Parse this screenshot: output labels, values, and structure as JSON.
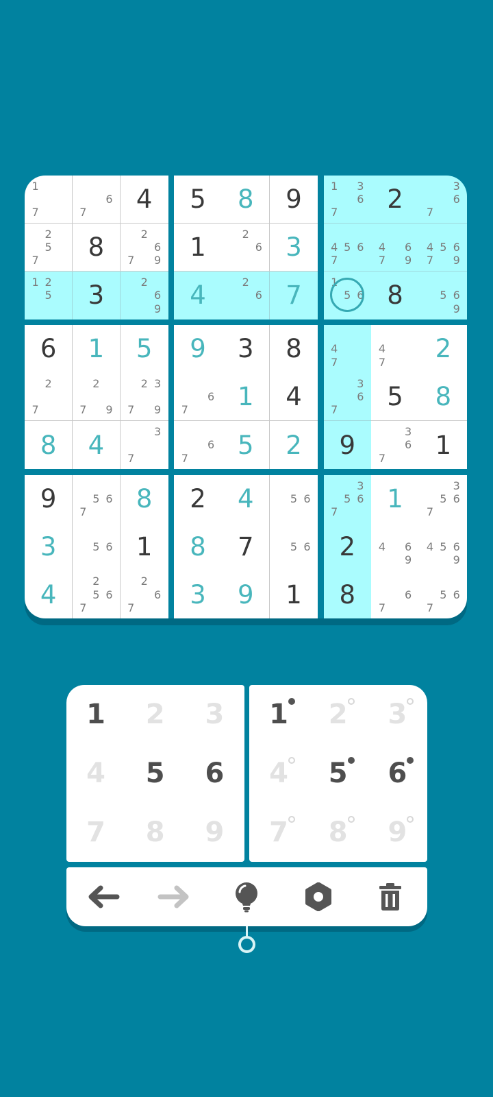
{
  "board": {
    "rows": [
      [
        {
          "n": [
            1,
            7
          ]
        },
        {
          "n": [
            6,
            7
          ]
        },
        {
          "v": 4,
          "t": "g"
        },
        {
          "v": 5,
          "t": "g"
        },
        {
          "v": 8,
          "t": "u"
        },
        {
          "v": 9,
          "t": "g"
        },
        {
          "n": [
            1,
            3,
            6,
            7
          ],
          "h": 1
        },
        {
          "v": 2,
          "t": "g",
          "h": 1
        },
        {
          "n": [
            3,
            6,
            7
          ],
          "h": 1
        }
      ],
      [
        {
          "n": [
            2,
            5,
            7
          ]
        },
        {
          "v": 8,
          "t": "g"
        },
        {
          "n": [
            2,
            6,
            7,
            9
          ]
        },
        {
          "v": 1,
          "t": "g"
        },
        {
          "n": [
            2,
            6
          ]
        },
        {
          "v": 3,
          "t": "u"
        },
        {
          "n": [
            4,
            5,
            6,
            7
          ],
          "h": 1
        },
        {
          "n": [
            4,
            6,
            7,
            9
          ],
          "h": 1
        },
        {
          "n": [
            4,
            5,
            6,
            7,
            9
          ],
          "h": 1
        }
      ],
      [
        {
          "n": [
            1,
            2,
            5
          ],
          "h": 1
        },
        {
          "v": 3,
          "t": "g",
          "h": 1
        },
        {
          "n": [
            2,
            6,
            9
          ],
          "h": 1
        },
        {
          "v": 4,
          "t": "u",
          "h": 1
        },
        {
          "n": [
            2,
            6
          ],
          "h": 1
        },
        {
          "v": 7,
          "t": "u",
          "h": 1
        },
        {
          "n": [
            1,
            5,
            6
          ],
          "h": 1,
          "sel": 1
        },
        {
          "v": 8,
          "t": "g",
          "h": 1
        },
        {
          "n": [
            5,
            6,
            9
          ],
          "h": 1
        }
      ],
      [
        {
          "v": 6,
          "t": "g"
        },
        {
          "v": 1,
          "t": "u"
        },
        {
          "v": 5,
          "t": "u"
        },
        {
          "v": 9,
          "t": "u"
        },
        {
          "v": 3,
          "t": "g"
        },
        {
          "v": 8,
          "t": "g"
        },
        {
          "n": [
            4,
            7
          ],
          "h": 1
        },
        {
          "n": [
            4,
            7
          ]
        },
        {
          "v": 2,
          "t": "u"
        }
      ],
      [
        {
          "n": [
            2,
            7
          ]
        },
        {
          "n": [
            2,
            7,
            9
          ]
        },
        {
          "n": [
            2,
            3,
            7,
            9
          ]
        },
        {
          "n": [
            6,
            7
          ]
        },
        {
          "v": 1,
          "t": "u"
        },
        {
          "v": 4,
          "t": "g"
        },
        {
          "n": [
            3,
            6,
            7
          ],
          "h": 1
        },
        {
          "v": 5,
          "t": "g"
        },
        {
          "v": 8,
          "t": "u"
        }
      ],
      [
        {
          "v": 8,
          "t": "u"
        },
        {
          "v": 4,
          "t": "u"
        },
        {
          "n": [
            3,
            7
          ]
        },
        {
          "n": [
            6,
            7
          ]
        },
        {
          "v": 5,
          "t": "u"
        },
        {
          "v": 2,
          "t": "u"
        },
        {
          "v": 9,
          "t": "g",
          "h": 1
        },
        {
          "n": [
            3,
            6,
            7
          ]
        },
        {
          "v": 1,
          "t": "g"
        }
      ],
      [
        {
          "v": 9,
          "t": "g"
        },
        {
          "n": [
            5,
            6,
            7
          ]
        },
        {
          "v": 8,
          "t": "u"
        },
        {
          "v": 2,
          "t": "g"
        },
        {
          "v": 4,
          "t": "u"
        },
        {
          "n": [
            5,
            6
          ]
        },
        {
          "n": [
            3,
            5,
            6,
            7
          ],
          "h": 1
        },
        {
          "v": 1,
          "t": "u"
        },
        {
          "n": [
            3,
            5,
            6,
            7
          ]
        }
      ],
      [
        {
          "v": 3,
          "t": "u"
        },
        {
          "n": [
            5,
            6
          ]
        },
        {
          "v": 1,
          "t": "g"
        },
        {
          "v": 8,
          "t": "u"
        },
        {
          "v": 7,
          "t": "g"
        },
        {
          "n": [
            5,
            6
          ]
        },
        {
          "v": 2,
          "t": "g",
          "h": 1
        },
        {
          "n": [
            4,
            6,
            9
          ]
        },
        {
          "n": [
            4,
            5,
            6,
            9
          ]
        }
      ],
      [
        {
          "v": 4,
          "t": "u"
        },
        {
          "n": [
            2,
            5,
            6,
            7
          ]
        },
        {
          "n": [
            2,
            6,
            7
          ]
        },
        {
          "v": 3,
          "t": "u"
        },
        {
          "v": 9,
          "t": "u"
        },
        {
          "v": 1,
          "t": "g"
        },
        {
          "v": 8,
          "t": "g",
          "h": 1
        },
        {
          "n": [
            6,
            7
          ]
        },
        {
          "n": [
            5,
            6,
            7
          ]
        }
      ]
    ]
  },
  "keypad_values": {
    "keys": [
      {
        "label": "1",
        "active": true
      },
      {
        "label": "2",
        "active": false
      },
      {
        "label": "3",
        "active": false
      },
      {
        "label": "4",
        "active": false
      },
      {
        "label": "5",
        "active": true
      },
      {
        "label": "6",
        "active": true
      },
      {
        "label": "7",
        "active": false
      },
      {
        "label": "8",
        "active": false
      },
      {
        "label": "9",
        "active": false
      }
    ]
  },
  "keypad_notes": {
    "keys": [
      {
        "label": "1",
        "active": true,
        "marked": true
      },
      {
        "label": "2",
        "active": false,
        "marked": false
      },
      {
        "label": "3",
        "active": false,
        "marked": false
      },
      {
        "label": "4",
        "active": false,
        "marked": false
      },
      {
        "label": "5",
        "active": true,
        "marked": true
      },
      {
        "label": "6",
        "active": true,
        "marked": true
      },
      {
        "label": "7",
        "active": false,
        "marked": false
      },
      {
        "label": "8",
        "active": false,
        "marked": false
      },
      {
        "label": "9",
        "active": false,
        "marked": false
      }
    ]
  },
  "toolbar": {
    "tools": [
      {
        "name": "undo-icon",
        "enabled": true
      },
      {
        "name": "redo-icon",
        "enabled": false
      },
      {
        "name": "hint-lightbulb-icon",
        "enabled": true
      },
      {
        "name": "settings-gear-icon",
        "enabled": true
      },
      {
        "name": "delete-trash-icon",
        "enabled": true
      }
    ]
  },
  "colors": {
    "background": "#01829f",
    "highlight": "#aafcfe",
    "user_digit": "#48b6bc",
    "given_digit": "#393939",
    "note_digit": "#7b7b7b",
    "selection_ring": "#36a9b3"
  }
}
